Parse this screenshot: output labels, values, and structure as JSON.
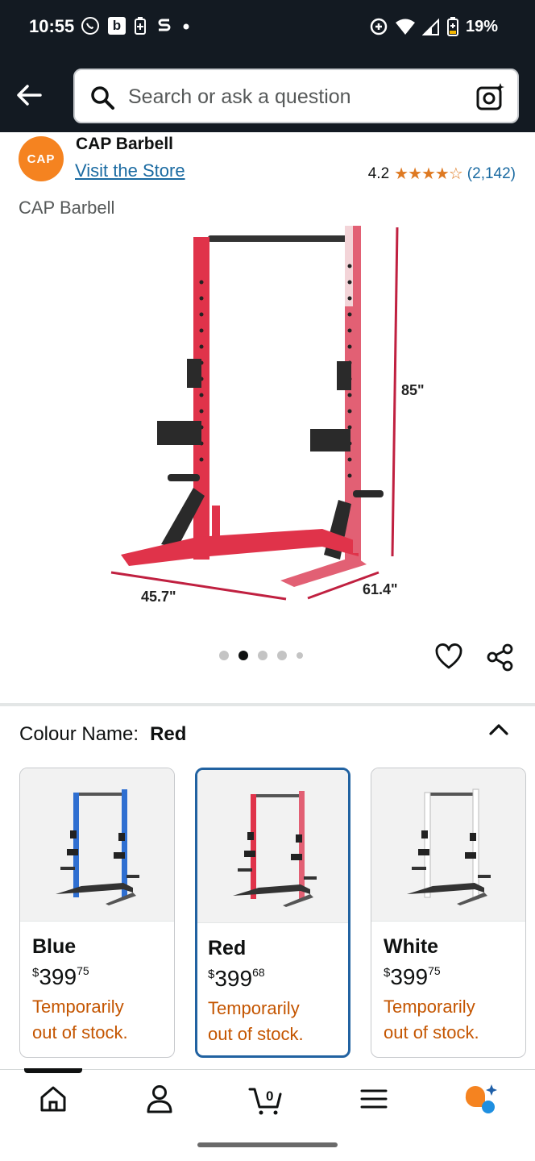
{
  "status_bar": {
    "time": "10:55",
    "battery": "19%",
    "icons": [
      "whatsapp-icon",
      "b-icon",
      "battery-saver-icon",
      "s-icon",
      "dot-icon",
      "data-saver-icon",
      "wifi-icon",
      "signal-icon",
      "battery-icon"
    ]
  },
  "header": {
    "search_placeholder": "Search or ask a question"
  },
  "brand": {
    "logo_text": "CAP",
    "name": "CAP Barbell",
    "visit_store": "Visit the Store",
    "subtitle": "CAP Barbell"
  },
  "rating": {
    "value": "4.2",
    "stars": "★★★★☆",
    "count": "(2,142)"
  },
  "product_image": {
    "dim_height": "85\"",
    "dim_width": "45.7\"",
    "dim_depth": "61.4\"",
    "frame_color": "#e0334a"
  },
  "carousel": {
    "total": 5,
    "active": 1
  },
  "colour": {
    "label": "Colour Name:",
    "selected": "Red"
  },
  "swatches": [
    {
      "name": "Blue",
      "dollar": "$",
      "price_whole": "399",
      "price_fraction": "75",
      "stock_line1": "Temporarily",
      "stock_line2": "out of stock.",
      "color": "#2f6fd1"
    },
    {
      "name": "Red",
      "dollar": "$",
      "price_whole": "399",
      "price_fraction": "68",
      "stock_line1": "Temporarily",
      "stock_line2": "out of stock.",
      "color": "#e0334a"
    },
    {
      "name": "White",
      "dollar": "$",
      "price_whole": "399",
      "price_fraction": "75",
      "stock_line1": "Temporarily",
      "stock_line2": "out of stock.",
      "color": "#e8e8e8"
    }
  ],
  "bottom_nav": {
    "items": [
      "home-icon",
      "account-icon",
      "cart-icon",
      "menu-icon",
      "rufus-icon"
    ],
    "cart_count": "0"
  },
  "colors": {
    "header_bg": "#131a22",
    "link": "#1a6aa1",
    "star": "#de7921",
    "stock": "#c45500",
    "selected_border": "#2162a1"
  }
}
